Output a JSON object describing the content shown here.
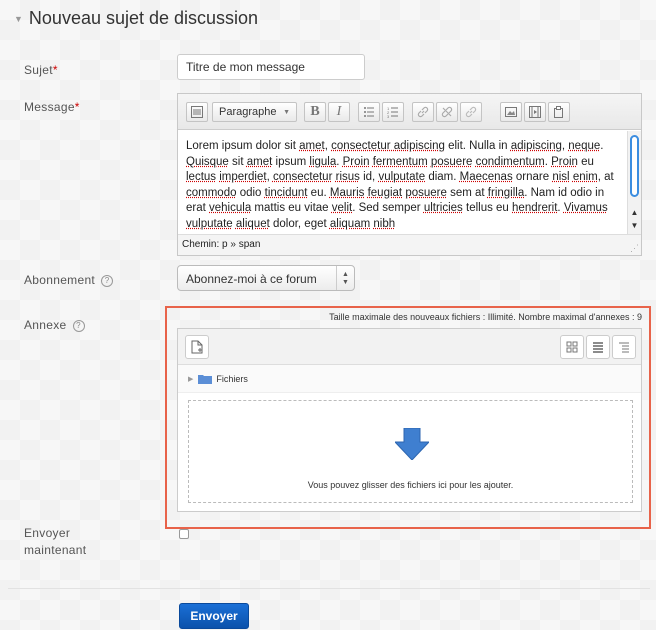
{
  "section": {
    "title": "Nouveau sujet de discussion",
    "toggle_icon": "triangle-down-icon"
  },
  "subject": {
    "label": "Sujet",
    "required_mark": "*",
    "value": "Titre de mon message"
  },
  "message": {
    "label": "Message",
    "required_mark": "*",
    "toolbar": {
      "paragraph_select": "Paragraphe",
      "bold": "B",
      "italic": "I"
    },
    "body": [
      {
        "t": "Lorem ipsum dolor sit "
      },
      {
        "t": "amet",
        "u": true
      },
      {
        "t": ", "
      },
      {
        "t": "consectetur adipiscing",
        "u": true
      },
      {
        "t": " elit. Nulla in "
      },
      {
        "t": "adipiscing",
        "u": true
      },
      {
        "t": ", "
      },
      {
        "t": "neque",
        "u": true
      },
      {
        "t": ". "
      },
      {
        "t": "Quisque",
        "u": true
      },
      {
        "t": " sit "
      },
      {
        "t": "amet",
        "u": true
      },
      {
        "t": " ipsum "
      },
      {
        "t": "ligula",
        "u": true
      },
      {
        "t": ". "
      },
      {
        "t": "Proin",
        "u": true
      },
      {
        "t": " "
      },
      {
        "t": "fermentum",
        "u": true
      },
      {
        "t": " "
      },
      {
        "t": "posuere",
        "u": true
      },
      {
        "t": " "
      },
      {
        "t": "condimentum",
        "u": true
      },
      {
        "t": ". "
      },
      {
        "t": "Proin",
        "u": true
      },
      {
        "t": " eu "
      },
      {
        "t": "lectus",
        "u": true
      },
      {
        "t": " "
      },
      {
        "t": "imperdiet",
        "u": true
      },
      {
        "t": ", "
      },
      {
        "t": "consectetur",
        "u": true
      },
      {
        "t": " "
      },
      {
        "t": "risus",
        "u": true
      },
      {
        "t": " id, "
      },
      {
        "t": "vulputate",
        "u": true
      },
      {
        "t": " diam. "
      },
      {
        "t": "Maecenas",
        "u": true
      },
      {
        "t": " "
      },
      {
        "t": "ornare "
      },
      {
        "t": "nisl",
        "u": true
      },
      {
        "t": " "
      },
      {
        "t": "enim",
        "u": true
      },
      {
        "t": ", at "
      },
      {
        "t": "commodo",
        "u": true
      },
      {
        "t": " odio "
      },
      {
        "t": "tincidunt",
        "u": true
      },
      {
        "t": " eu. "
      },
      {
        "t": "Mauris",
        "u": true
      },
      {
        "t": " "
      },
      {
        "t": "feugiat",
        "u": true
      },
      {
        "t": " "
      },
      {
        "t": "posuere",
        "u": true
      },
      {
        "t": " sem at "
      },
      {
        "t": "fringilla",
        "u": true
      },
      {
        "t": ". Nam id odio in erat "
      },
      {
        "t": "vehicula",
        "u": true
      },
      {
        "t": " mattis eu vitae "
      },
      {
        "t": "velit",
        "u": true
      },
      {
        "t": ". Sed semper "
      },
      {
        "t": "ultricies",
        "u": true
      },
      {
        "t": " "
      },
      {
        "t": "tellus eu "
      },
      {
        "t": "hendrerit",
        "u": true
      },
      {
        "t": ". "
      },
      {
        "t": "Vivamus",
        "u": true
      },
      {
        "t": " "
      },
      {
        "t": "vulputate",
        "u": true
      },
      {
        "t": " "
      },
      {
        "t": "aliquet",
        "u": true
      },
      {
        "t": " dolor, eget "
      },
      {
        "t": "aliquam",
        "u": true
      },
      {
        "t": " "
      },
      {
        "t": "nibh",
        "u": true
      }
    ],
    "path": "Chemin: p » span"
  },
  "subscription": {
    "label": "Abonnement",
    "selected": "Abonnez-moi à ce forum"
  },
  "attachment": {
    "label": "Annexe",
    "info": "Taille maximale des nouveaux fichiers : Illimité. Nombre maximal d'annexes : 9",
    "folder": "Fichiers",
    "drop_hint": "Vous pouvez glisser des fichiers ici pour les ajouter.",
    "highlight_color": "#e8634a"
  },
  "send_now": {
    "label_line1": "Envoyer",
    "label_line2": "maintenant",
    "checked": false
  },
  "submit": {
    "label": "Envoyer",
    "color": "#0c52ab"
  }
}
